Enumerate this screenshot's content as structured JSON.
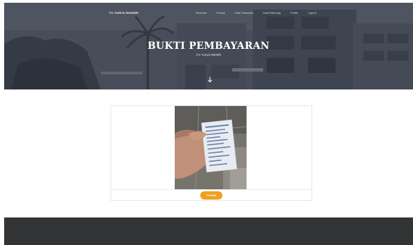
{
  "navbar": {
    "brand": "CV. KARYA MANDIRI",
    "links": [
      "Beranda",
      "Produk",
      "Data Transaksi",
      "Data Retturing",
      "Profile",
      "Logout"
    ]
  },
  "hero": {
    "title": "BUKTI PEMBAYARAN",
    "subtitle": "CV. Karya Mandiri",
    "scroll_icon": "arrow-down-icon"
  },
  "content": {
    "image_description_icon": "payment-receipt-photo",
    "back_button_label": "Kembali"
  },
  "colors": {
    "accent": "#f0a020",
    "hero_overlay": "#4c5560",
    "footer": "#333436"
  }
}
